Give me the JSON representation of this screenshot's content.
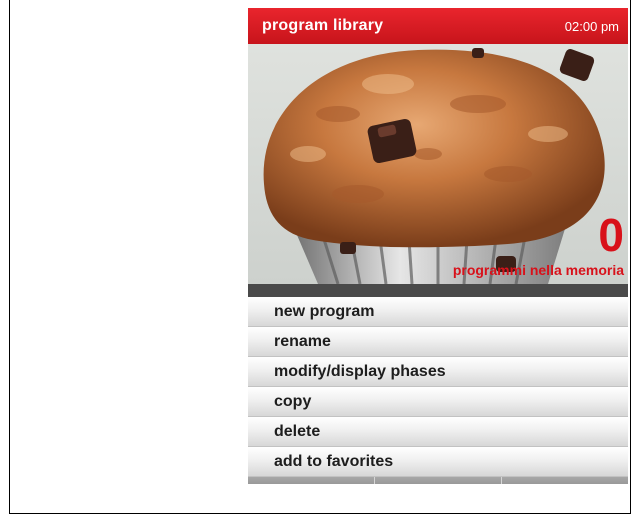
{
  "header": {
    "title": "program library",
    "time": "02:00 pm"
  },
  "hero": {
    "image": "muffin-photo",
    "program_count": "0",
    "program_count_label": "programmi nella memoria"
  },
  "menu": {
    "items": [
      {
        "label": "new program"
      },
      {
        "label": "rename"
      },
      {
        "label": "modify/display phases"
      },
      {
        "label": "copy"
      },
      {
        "label": "delete"
      },
      {
        "label": "add to favorites"
      }
    ]
  },
  "soft_keys": {
    "count": 3
  },
  "colors": {
    "header": "#d8111a",
    "accent_text": "#d8111a",
    "menu_text": "#1d1d1d"
  }
}
